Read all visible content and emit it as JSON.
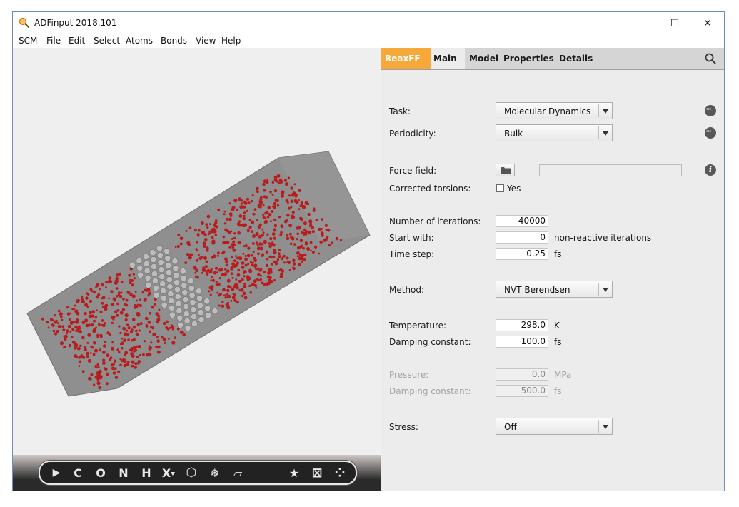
{
  "window": {
    "title": "ADFinput 2018.101",
    "controls": {
      "minimize": "—",
      "maximize": "☐",
      "close": "✕"
    }
  },
  "menu": [
    "SCM",
    "File",
    "Edit",
    "Select",
    "Atoms",
    "Bonds",
    "View",
    "Help"
  ],
  "toolbar": {
    "tools": [
      {
        "name": "select-tool",
        "glyph": "▶"
      },
      {
        "name": "carbon-tool",
        "glyph": "C"
      },
      {
        "name": "oxygen-tool",
        "glyph": "O"
      },
      {
        "name": "nitrogen-tool",
        "glyph": "N"
      },
      {
        "name": "hydrogen-tool",
        "glyph": "H"
      },
      {
        "name": "other-element-tool",
        "glyph": "X"
      },
      {
        "name": "ring-tool",
        "glyph": "⬡"
      },
      {
        "name": "freeze-tool",
        "glyph": "❄"
      },
      {
        "name": "plane-tool",
        "glyph": "▱"
      },
      {
        "name": "favorites-tool",
        "glyph": "★"
      },
      {
        "name": "box-tool",
        "glyph": "⊠"
      },
      {
        "name": "fragments-tool",
        "glyph": "⁘"
      }
    ]
  },
  "tabs": {
    "engine": "ReaxFF",
    "items": [
      "Main",
      "Model",
      "Properties",
      "Details"
    ],
    "active": "Main"
  },
  "form": {
    "task": {
      "label": "Task:",
      "value": "Molecular Dynamics"
    },
    "periodicity": {
      "label": "Periodicity:",
      "value": "Bulk"
    },
    "force_field": {
      "label": "Force field:",
      "value": ""
    },
    "corrected_torsions": {
      "label": "Corrected torsions:",
      "option": "Yes",
      "checked": false
    },
    "iterations": {
      "label": "Number of iterations:",
      "value": "40000"
    },
    "start_with": {
      "label": "Start with:",
      "value": "0",
      "suffix": "non-reactive iterations"
    },
    "time_step": {
      "label": "Time step:",
      "value": "0.25",
      "unit": "fs"
    },
    "method": {
      "label": "Method:",
      "value": "NVT Berendsen"
    },
    "temperature": {
      "label": "Temperature:",
      "value": "298.0",
      "unit": "K"
    },
    "damping": {
      "label": "Damping constant:",
      "value": "100.0",
      "unit": "fs"
    },
    "pressure": {
      "label": "Pressure:",
      "value": "0.0",
      "unit": "MPa"
    },
    "p_damping": {
      "label": "Damping constant:",
      "value": "500.0",
      "unit": "fs"
    },
    "stress": {
      "label": "Stress:",
      "value": "Off"
    }
  },
  "colors": {
    "accent": "#f6a83a",
    "atom_oxygen": "#b81c1c",
    "atom_carbon": "#bdbdbd",
    "cell": "#8c8c8c"
  }
}
